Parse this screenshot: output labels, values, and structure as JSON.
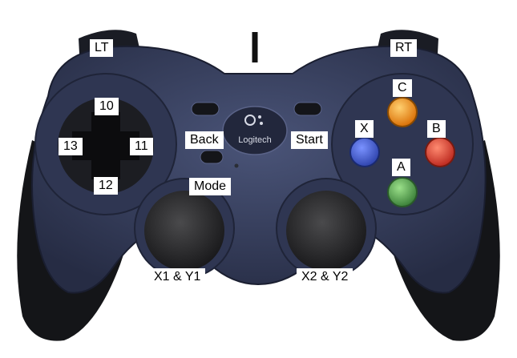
{
  "brand": {
    "logo_text": "Logitech"
  },
  "labels": {
    "lt": "LT",
    "rt": "RT",
    "dpad_up": "10",
    "dpad_right": "11",
    "dpad_down": "12",
    "dpad_left": "13",
    "back": "Back",
    "start": "Start",
    "mode": "Mode",
    "button_x": "X",
    "button_a": "A",
    "button_b": "B",
    "button_c": "C",
    "left_stick": "X1 & Y1",
    "right_stick": "X2 & Y2"
  },
  "colors": {
    "body": "#3a4260",
    "body_dark": "#1e2336",
    "grip": "#17181c",
    "button_x": "#3b56c7",
    "button_a": "#4fa14c",
    "button_b": "#e5382c",
    "button_c": "#f08a10"
  }
}
